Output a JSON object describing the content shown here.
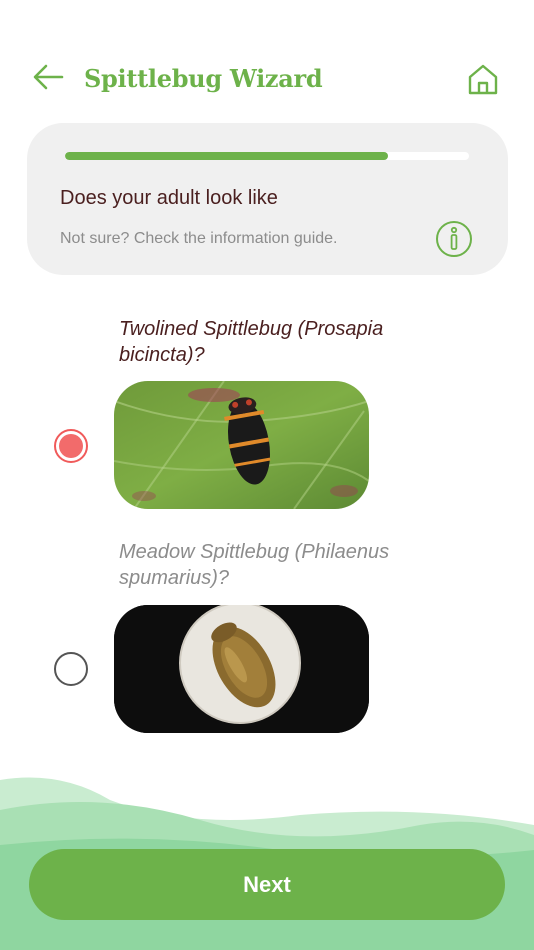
{
  "header": {
    "title": "Spittlebug Wizard",
    "back_icon": "arrow-left-icon",
    "home_icon": "home-icon"
  },
  "card": {
    "progress_fraction": 0.8,
    "question": "Does your adult look like",
    "hint": "Not sure? Check the information guide.",
    "info_icon": "info-icon"
  },
  "options": [
    {
      "label": "Twolined Spittlebug (Prosapia bicincta)?",
      "selected": true
    },
    {
      "label": "Meadow Spittlebug (Philaenus spumarius)?",
      "selected": false
    }
  ],
  "footer": {
    "next_label": "Next"
  },
  "colors": {
    "accent_green": "#6db24a",
    "selected_red": "#f26b6b",
    "dark_text": "#4a1f1f",
    "muted_text": "#8c8c8c",
    "card_bg": "#f0f0f0"
  }
}
